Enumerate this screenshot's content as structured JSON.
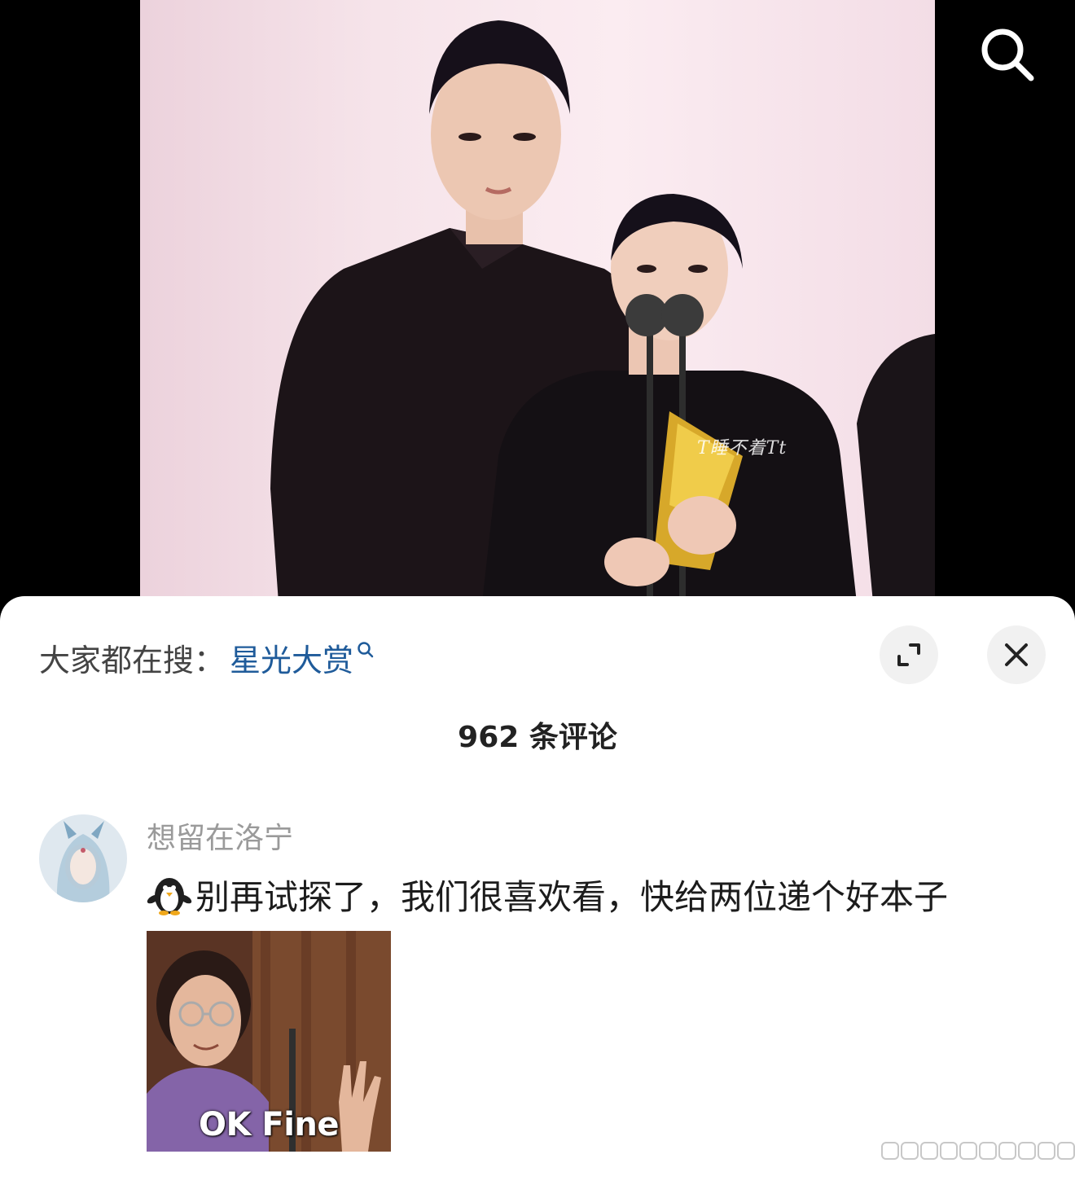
{
  "video": {
    "watermark": "T睡不着Tt",
    "search_icon": "search-icon"
  },
  "sheet": {
    "hot_search_prefix": "大家都在搜：",
    "hot_search_term": "星光大赏",
    "expand_icon": "expand-icon",
    "close_icon": "close-icon",
    "comment_count": "962 条评论"
  },
  "comment": {
    "username": "想留在洛宁",
    "text": "别再试探了，我们很喜欢看，快给两位递个好本子",
    "emoji": "penguin-icon",
    "meme_caption": "OK Fine"
  },
  "colors": {
    "link": "#1f5b9a",
    "username": "#9a9a9a",
    "text": "#1c1c1c"
  }
}
